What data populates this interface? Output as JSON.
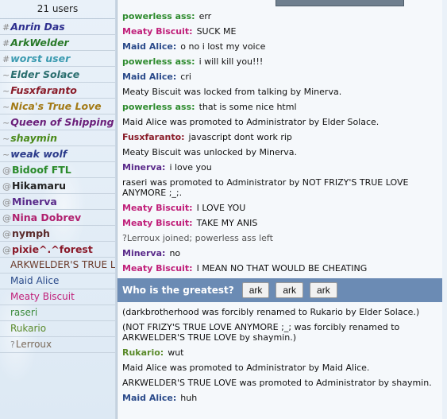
{
  "userlist": {
    "count_label": "21 users",
    "users": [
      {
        "symbol": "#",
        "name": "Anrin Das",
        "color": "#2e2f8f",
        "style": "admin"
      },
      {
        "symbol": "#",
        "name": "ArkWelder",
        "color": "#2a7a2a",
        "style": "admin"
      },
      {
        "symbol": "#",
        "name": "worst user",
        "color": "#3a9ab0",
        "style": "admin"
      },
      {
        "symbol": "~",
        "name": "Elder Solace",
        "color": "#2a6e6e",
        "style": "admin"
      },
      {
        "symbol": "~",
        "name": "Fusxfaranto",
        "color": "#8a1d2a",
        "style": "admin"
      },
      {
        "symbol": "~",
        "name": "Nica's True Love",
        "color": "#a37a16",
        "style": "admin"
      },
      {
        "symbol": "~",
        "name": "Queen of Shipping",
        "color": "#6b1f7a",
        "style": "admin"
      },
      {
        "symbol": "~",
        "name": "shaymin",
        "color": "#4a8a1a",
        "style": "admin"
      },
      {
        "symbol": "~",
        "name": "weak wolf",
        "color": "#2a3a8a",
        "style": "admin"
      },
      {
        "symbol": "@",
        "name": "Bidoof FTL",
        "color": "#2a8a2a",
        "style": "mod"
      },
      {
        "symbol": "@",
        "name": "Hikamaru",
        "color": "#222222",
        "style": "mod"
      },
      {
        "symbol": "@",
        "name": "Minerva",
        "color": "#5a2a8a",
        "style": "mod"
      },
      {
        "symbol": "@",
        "name": "Nina Dobrev",
        "color": "#b0206e",
        "style": "mod"
      },
      {
        "symbol": "@",
        "name": "nymph",
        "color": "#5a2a2a",
        "style": "mod"
      },
      {
        "symbol": "@",
        "name": "pixie^.^forest",
        "color": "#8a1a2a",
        "style": "mod"
      },
      {
        "symbol": "",
        "name": "ARKWELDER'S TRUE LOVE",
        "color": "#6a3a2a",
        "style": "plain"
      },
      {
        "symbol": "",
        "name": "Maid Alice",
        "color": "#2a4a8a",
        "style": "plain"
      },
      {
        "symbol": "",
        "name": "Meaty Biscuit",
        "color": "#c0207a",
        "style": "plain"
      },
      {
        "symbol": "",
        "name": "raseri",
        "color": "#3a8a3a",
        "style": "plain"
      },
      {
        "symbol": "",
        "name": "Rukario",
        "color": "#5a8a2a",
        "style": "plain"
      },
      {
        "symbol": "?",
        "name": "Lerroux",
        "color": "#7a6a5a",
        "style": "plain"
      }
    ]
  },
  "chat": {
    "messages": [
      {
        "type": "user",
        "who": "powerless ass:",
        "color": "#2e8b2e",
        "text": "err"
      },
      {
        "type": "user",
        "who": "Meaty Biscuit:",
        "color": "#c0207a",
        "text": "SUCK ME"
      },
      {
        "type": "user",
        "who": "Maid Alice:",
        "color": "#2a4a8a",
        "text": "o no i lost my voice"
      },
      {
        "type": "user",
        "who": "powerless ass:",
        "color": "#2e8b2e",
        "text": "i will kill you!!!"
      },
      {
        "type": "user",
        "who": "Maid Alice:",
        "color": "#2a4a8a",
        "text": "cri"
      },
      {
        "type": "system",
        "text": "Meaty Biscuit was locked from talking by Minerva."
      },
      {
        "type": "user",
        "who": "powerless ass:",
        "color": "#2e8b2e",
        "text": "that is some nice html"
      },
      {
        "type": "system",
        "text": "Maid Alice was promoted to Administrator by Elder Solace."
      },
      {
        "type": "user",
        "who": "Fusxfaranto:",
        "color": "#8a1d2a",
        "text": "javascript dont work rip"
      },
      {
        "type": "system",
        "text": "Meaty Biscuit was unlocked by Minerva."
      },
      {
        "type": "user",
        "who": "Minerva:",
        "color": "#5a2a8a",
        "text": "i love you"
      },
      {
        "type": "system",
        "text": "raseri was promoted to Administrator by NOT FRIZY'S TRUE LOVE ANYMORE ;_;."
      },
      {
        "type": "user",
        "who": "Meaty Biscuit:",
        "color": "#c0207a",
        "text": "I LOVE YOU"
      },
      {
        "type": "user",
        "who": "Meaty Biscuit:",
        "color": "#c0207a",
        "text": "TAKE MY ANIS"
      },
      {
        "type": "join",
        "text": "?Lerroux joined; powerless ass left"
      },
      {
        "type": "user",
        "who": "Minerva:",
        "color": "#5a2a8a",
        "text": "no"
      },
      {
        "type": "user",
        "who": "Meaty Biscuit:",
        "color": "#c0207a",
        "text": "I MEAN NO THAT WOULD BE CHEATING"
      },
      {
        "type": "poll",
        "question": "Who is the greatest?",
        "options": [
          "ark",
          "ark",
          "ark"
        ]
      },
      {
        "type": "system",
        "text": "(darkbrotherhood was forcibly renamed to Rukario by Elder Solace.)"
      },
      {
        "type": "system",
        "text": "(NOT FRIZY'S TRUE LOVE ANYMORE ;_; was forcibly renamed to ARKWELDER'S TRUE LOVE by shaymin.)"
      },
      {
        "type": "user",
        "who": "Rukario:",
        "color": "#5a8a2a",
        "text": "wut"
      },
      {
        "type": "system",
        "text": "Maid Alice was promoted to Administrator by Maid Alice."
      },
      {
        "type": "system",
        "text": "ARKWELDER'S TRUE LOVE was promoted to Administrator by shaymin."
      },
      {
        "type": "user",
        "who": "Maid Alice:",
        "color": "#2a4a8a",
        "text": "huh"
      }
    ]
  },
  "colors": {
    "poll_bar": "#6b8bb4",
    "list_bg": "#e4eef7",
    "chat_bg": "#f5f8fb"
  }
}
